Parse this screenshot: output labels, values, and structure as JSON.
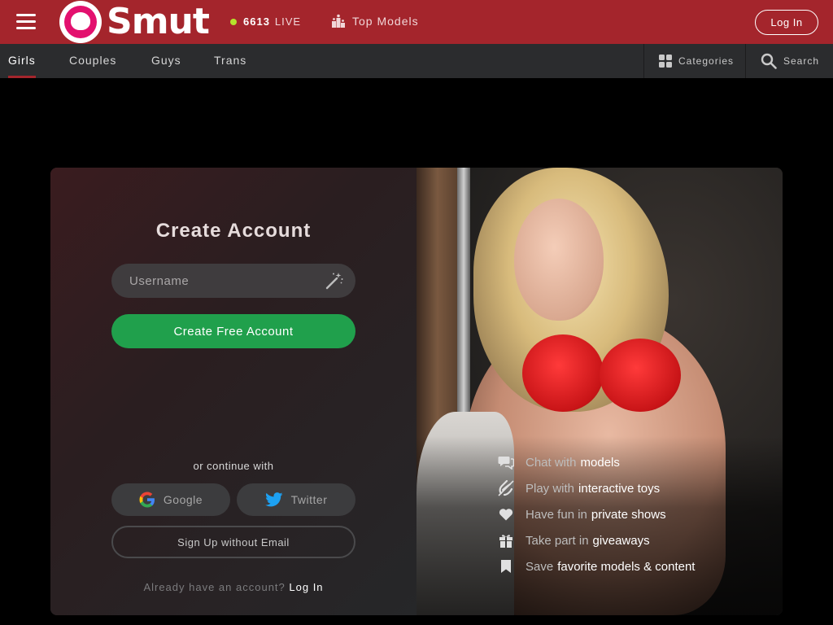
{
  "header": {
    "logo_text": "Smut",
    "live_count": "6613",
    "live_label": "LIVE",
    "top_models_label": "Top Models",
    "login_label": "Log In",
    "accent_color": "#a4252c"
  },
  "nav": {
    "tabs": [
      {
        "label": "Girls",
        "active": true
      },
      {
        "label": "Couples",
        "active": false
      },
      {
        "label": "Guys",
        "active": false
      },
      {
        "label": "Trans",
        "active": false
      }
    ],
    "categories_label": "Categories",
    "search_label": "Search"
  },
  "signup": {
    "title": "Create Account",
    "username_placeholder": "Username",
    "create_button": "Create Free Account",
    "or_continue": "or continue with",
    "google_label": "Google",
    "twitter_label": "Twitter",
    "no_email_label": "Sign Up without Email",
    "already_text": "Already have an account?",
    "login_link": "Log In",
    "button_color": "#20a04c"
  },
  "features": [
    {
      "icon": "chat-icon",
      "prefix": "Chat with",
      "highlight": "models"
    },
    {
      "icon": "toys-icon",
      "prefix": "Play with",
      "highlight": "interactive toys"
    },
    {
      "icon": "heart-icon",
      "prefix": "Have fun in",
      "highlight": "private shows"
    },
    {
      "icon": "gift-icon",
      "prefix": "Take part in",
      "highlight": "giveaways"
    },
    {
      "icon": "bookmark-icon",
      "prefix": "Save",
      "highlight": "favorite models & content"
    }
  ]
}
